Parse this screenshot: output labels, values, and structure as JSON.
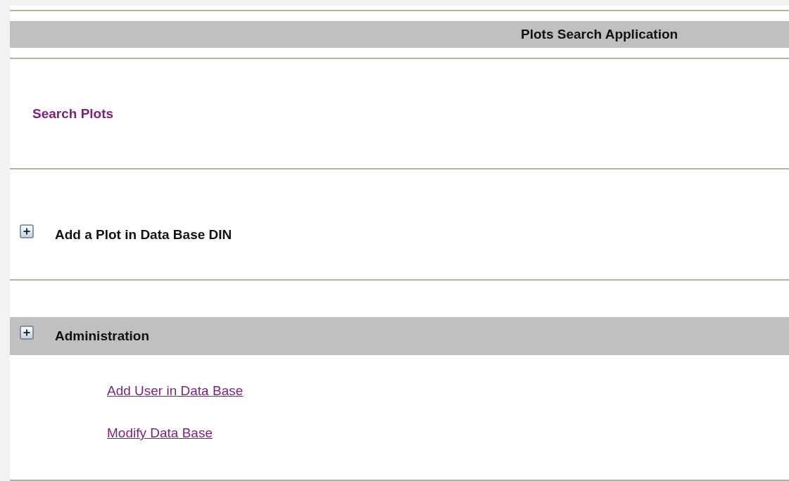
{
  "header": {
    "title": "Plots Search Application"
  },
  "search_link": {
    "label": "Search Plots"
  },
  "sections": [
    {
      "title": "Add a Plot in Data Base DIN",
      "expanded": false,
      "highlighted": false
    },
    {
      "title": "Administration",
      "expanded": false,
      "highlighted": true,
      "links": [
        "Add User in Data Base",
        "Modify Data Base"
      ]
    }
  ]
}
